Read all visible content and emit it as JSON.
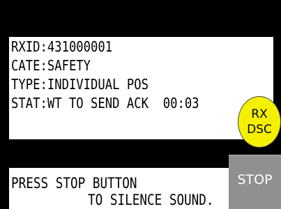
{
  "alert_info": {
    "rxid": "RXID:431000001",
    "category": "CATE:SAFETY",
    "type": "TYPE:INDIVIDUAL POS",
    "status": "STAT:WT TO SEND ACK",
    "timer": "00:03"
  },
  "indicator": {
    "line1": "RX",
    "line2": "DSC",
    "color": "#f5f000"
  },
  "message": {
    "line1": "PRESS STOP BUTTON",
    "line2": "TO SILENCE SOUND."
  },
  "stop_button": {
    "label": "STOP",
    "color": "#909090"
  }
}
